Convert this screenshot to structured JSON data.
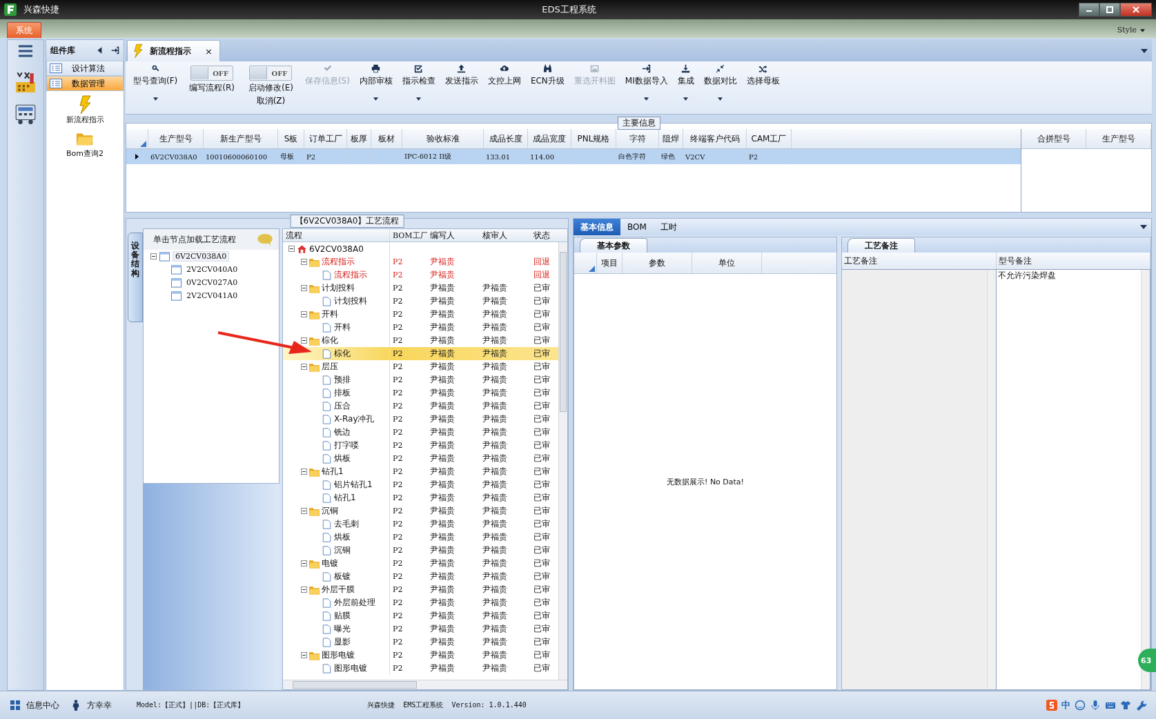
{
  "window": {
    "app_name": "兴森快捷",
    "title": "EDS工程系统"
  },
  "menu": {
    "system": "系统",
    "style": "Style"
  },
  "component_panel": {
    "title": "组件库",
    "items": [
      {
        "label": "设计算法",
        "selected": false
      },
      {
        "label": "数据管理",
        "selected": true
      }
    ],
    "shortcuts": [
      {
        "label": "新流程指示",
        "kind": "bolt"
      },
      {
        "label": "Bom查询2",
        "kind": "folder"
      }
    ]
  },
  "doc_tab": {
    "label": "新流程指示",
    "close": "×"
  },
  "toolbar": [
    {
      "kind": "button",
      "label": "型号查询(F)",
      "disabled": false,
      "dropdown": true
    },
    {
      "kind": "toggle",
      "state_text": "OFF",
      "on": false,
      "label": "编写流程(R)"
    },
    {
      "kind": "toggle",
      "state_text": "OFF",
      "on": false,
      "label": "启动修改(E)",
      "sublabel": "取消(Z)"
    },
    {
      "kind": "button",
      "label": "保存信息(S)",
      "disabled": true,
      "dropdown": false
    },
    {
      "kind": "button",
      "label": "内部审核",
      "disabled": false,
      "dropdown": true
    },
    {
      "kind": "button",
      "label": "指示检查",
      "disabled": false,
      "dropdown": true
    },
    {
      "kind": "button",
      "label": "发送指示",
      "disabled": false,
      "dropdown": false
    },
    {
      "kind": "button",
      "label": "文控上网",
      "disabled": false,
      "dropdown": false
    },
    {
      "kind": "button",
      "label": "ECN升级",
      "disabled": false,
      "dropdown": false
    },
    {
      "kind": "button",
      "label": "重选开料图",
      "disabled": true,
      "dropdown": false
    },
    {
      "kind": "button",
      "label": "MI数据导入",
      "disabled": false,
      "dropdown": true
    },
    {
      "kind": "button",
      "label": "集成",
      "disabled": false,
      "dropdown": true
    },
    {
      "kind": "button",
      "label": "数据对比",
      "disabled": false,
      "dropdown": true
    },
    {
      "kind": "button",
      "label": "选择母板",
      "disabled": false,
      "dropdown": false
    }
  ],
  "main_info": {
    "title": "主要信息",
    "columns": [
      "生产型号",
      "新生产型号",
      "S板",
      "订单工厂",
      "板厚",
      "板材",
      "验收标准",
      "成品长度",
      "成品宽度",
      "PNL规格",
      "字符",
      "阻焊",
      "终端客户代码",
      "CAM工厂"
    ],
    "rows": [
      {
        "selected": true,
        "cells": [
          "6V2CV038A0",
          "10010600060100",
          "母板",
          "P2",
          "",
          "",
          "IPC-6012 II级",
          "133.01",
          "114.00",
          "",
          "白色字符",
          "绿色",
          "V2CV",
          "P2"
        ]
      }
    ],
    "merge_columns": [
      "合拼型号",
      "生产型号"
    ]
  },
  "device_panel": {
    "tab": "设备结构",
    "hint": "单击节点加载工艺流程",
    "tree": {
      "name": "6V2CV038A0",
      "selected": true,
      "expanded": true,
      "children": [
        {
          "name": "2V2CV040A0",
          "selected": false
        },
        {
          "name": "0V2CV027A0",
          "selected": false
        },
        {
          "name": "2V2CV041A0",
          "selected": false
        }
      ]
    }
  },
  "flow": {
    "title": "【6V2CV038A0】工艺流程",
    "columns": [
      "流程",
      "BOM工厂",
      "编写人",
      "核审人",
      "状态"
    ],
    "root": {
      "name": "6V2CV038A0",
      "kind": "home",
      "expanded": true,
      "selected": false,
      "children": [
        {
          "name": "流程指示",
          "kind": "folder",
          "expanded": true,
          "selected": false,
          "bom": "P2",
          "writer": "尹福贵",
          "status": "回退",
          "returned": true,
          "children": [
            {
              "name": "流程指示",
              "kind": "file",
              "selected": false,
              "bom": "P2",
              "writer": "尹福贵",
              "status": "回退",
              "returned": true
            }
          ]
        },
        {
          "name": "计划投料",
          "kind": "folder",
          "expanded": true,
          "selected": false,
          "bom": "P2",
          "writer": "尹福贵",
          "reviewer": "尹福贵",
          "status": "已审",
          "returned": false,
          "children": [
            {
              "name": "计划投料",
              "kind": "file",
              "selected": false,
              "bom": "P2",
              "writer": "尹福贵",
              "reviewer": "尹福贵",
              "status": "已审",
              "returned": false
            }
          ]
        },
        {
          "name": "开料",
          "kind": "folder",
          "expanded": true,
          "selected": false,
          "bom": "P2",
          "writer": "尹福贵",
          "reviewer": "尹福贵",
          "status": "已审",
          "returned": false,
          "children": [
            {
              "name": "开料",
              "kind": "file",
              "selected": false,
              "bom": "P2",
              "writer": "尹福贵",
              "reviewer": "尹福贵",
              "status": "已审",
              "returned": false
            }
          ]
        },
        {
          "name": "棕化",
          "kind": "folder",
          "expanded": true,
          "selected": false,
          "bom": "P2",
          "writer": "尹福贵",
          "reviewer": "尹福贵",
          "status": "已审",
          "returned": false,
          "children": [
            {
              "name": "棕化",
              "kind": "file",
              "selected": true,
              "bom": "P2",
              "writer": "尹福贵",
              "reviewer": "尹福贵",
              "status": "已审",
              "returned": false
            }
          ]
        },
        {
          "name": "层压",
          "kind": "folder",
          "expanded": true,
          "selected": false,
          "bom": "P2",
          "writer": "尹福贵",
          "reviewer": "尹福贵",
          "status": "已审",
          "returned": false,
          "children": [
            {
              "name": "预排",
              "kind": "file",
              "selected": false,
              "bom": "P2",
              "writer": "尹福贵",
              "reviewer": "尹福贵",
              "status": "已审",
              "returned": false
            },
            {
              "name": "排板",
              "kind": "file",
              "selected": false,
              "bom": "P2",
              "writer": "尹福贵",
              "reviewer": "尹福贵",
              "status": "已审",
              "returned": false
            },
            {
              "name": "压合",
              "kind": "file",
              "selected": false,
              "bom": "P2",
              "writer": "尹福贵",
              "reviewer": "尹福贵",
              "status": "已审",
              "returned": false
            },
            {
              "name": "X-Ray冲孔",
              "kind": "file",
              "selected": false,
              "bom": "P2",
              "writer": "尹福贵",
              "reviewer": "尹福贵",
              "status": "已审",
              "returned": false
            },
            {
              "name": "铣边",
              "kind": "file",
              "selected": false,
              "bom": "P2",
              "writer": "尹福贵",
              "reviewer": "尹福贵",
              "status": "已审",
              "returned": false
            },
            {
              "name": "打字喽",
              "kind": "file",
              "selected": false,
              "bom": "P2",
              "writer": "尹福贵",
              "reviewer": "尹福贵",
              "status": "已审",
              "returned": false
            },
            {
              "name": "烘板",
              "kind": "file",
              "selected": false,
              "bom": "P2",
              "writer": "尹福贵",
              "reviewer": "尹福贵",
              "status": "已审",
              "returned": false
            }
          ]
        },
        {
          "name": "钻孔1",
          "kind": "folder",
          "expanded": true,
          "selected": false,
          "bom": "P2",
          "writer": "尹福贵",
          "reviewer": "尹福贵",
          "status": "已审",
          "returned": false,
          "children": [
            {
              "name": "铝片钻孔1",
              "kind": "file",
              "selected": false,
              "bom": "P2",
              "writer": "尹福贵",
              "reviewer": "尹福贵",
              "status": "已审",
              "returned": false
            },
            {
              "name": "钻孔1",
              "kind": "file",
              "selected": false,
              "bom": "P2",
              "writer": "尹福贵",
              "reviewer": "尹福贵",
              "status": "已审",
              "returned": false
            }
          ]
        },
        {
          "name": "沉铜",
          "kind": "folder",
          "expanded": true,
          "selected": false,
          "bom": "P2",
          "writer": "尹福贵",
          "reviewer": "尹福贵",
          "status": "已审",
          "returned": false,
          "children": [
            {
              "name": "去毛刺",
              "kind": "file",
              "selected": false,
              "bom": "P2",
              "writer": "尹福贵",
              "reviewer": "尹福贵",
              "status": "已审",
              "returned": false
            },
            {
              "name": "烘板",
              "kind": "file",
              "selected": false,
              "bom": "P2",
              "writer": "尹福贵",
              "reviewer": "尹福贵",
              "status": "已审",
              "returned": false
            },
            {
              "name": "沉铜",
              "kind": "file",
              "selected": false,
              "bom": "P2",
              "writer": "尹福贵",
              "reviewer": "尹福贵",
              "status": "已审",
              "returned": false
            }
          ]
        },
        {
          "name": "电镀",
          "kind": "folder",
          "expanded": true,
          "selected": false,
          "bom": "P2",
          "writer": "尹福贵",
          "reviewer": "尹福贵",
          "status": "已审",
          "returned": false,
          "children": [
            {
              "name": "板镀",
              "kind": "file",
              "selected": false,
              "bom": "P2",
              "writer": "尹福贵",
              "reviewer": "尹福贵",
              "status": "已审",
              "returned": false
            }
          ]
        },
        {
          "name": "外层干膜",
          "kind": "folder",
          "expanded": true,
          "selected": false,
          "bom": "P2",
          "writer": "尹福贵",
          "reviewer": "尹福贵",
          "status": "已审",
          "returned": false,
          "children": [
            {
              "name": "外层前处理",
              "kind": "file",
              "selected": false,
              "bom": "P2",
              "writer": "尹福贵",
              "reviewer": "尹福贵",
              "status": "已审",
              "returned": false
            },
            {
              "name": "贴膜",
              "kind": "file",
              "selected": false,
              "bom": "P2",
              "writer": "尹福贵",
              "reviewer": "尹福贵",
              "status": "已审",
              "returned": false
            },
            {
              "name": "曝光",
              "kind": "file",
              "selected": false,
              "bom": "P2",
              "writer": "尹福贵",
              "reviewer": "尹福贵",
              "status": "已审",
              "returned": false
            },
            {
              "name": "显影",
              "kind": "file",
              "selected": false,
              "bom": "P2",
              "writer": "尹福贵",
              "reviewer": "尹福贵",
              "status": "已审",
              "returned": false
            }
          ]
        },
        {
          "name": "图形电镀",
          "kind": "folder",
          "expanded": true,
          "selected": false,
          "bom": "P2",
          "writer": "尹福贵",
          "reviewer": "尹福贵",
          "status": "已审",
          "returned": false,
          "children": [
            {
              "name": "图形电镀",
              "kind": "file",
              "selected": false,
              "bom": "P2",
              "writer": "尹福贵",
              "reviewer": "尹福贵",
              "status": "已审",
              "returned": false
            }
          ]
        }
      ]
    }
  },
  "detail_tabs": [
    {
      "label": "基本信息",
      "selected": true
    },
    {
      "label": "BOM",
      "selected": false
    },
    {
      "label": "工时",
      "selected": false
    }
  ],
  "basic_params": {
    "tab": "基本参数",
    "columns": [
      "项目",
      "参数",
      "单位"
    ],
    "empty_text": "无数据展示! No Data!"
  },
  "process_notes": {
    "tab": "工艺备注",
    "columns": [
      "工艺备注",
      "型号备注"
    ],
    "model_note": "不允许污染焊盘"
  },
  "float_badge": "63",
  "status_bar": {
    "info_center": "信息中心",
    "user": "方幸幸",
    "model": "Model:【正式】||DB:【正式库】",
    "version": "兴森快捷  EMS工程系统  Version: 1.0.1.440",
    "ime": "中"
  }
}
